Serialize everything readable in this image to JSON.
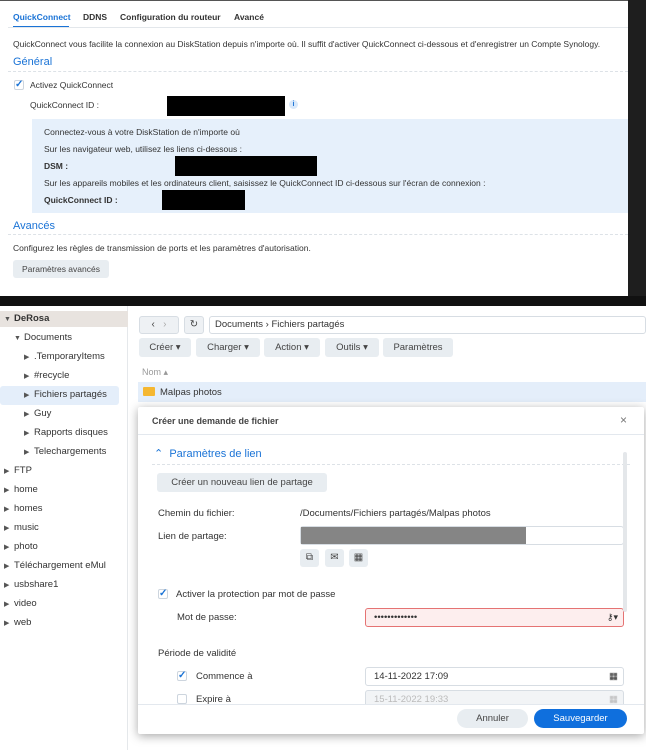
{
  "quickconnect": {
    "tabs": [
      "QuickConnect",
      "DDNS",
      "Configuration du routeur",
      "Avancé"
    ],
    "intro": "QuickConnect vous facilite la connexion au DiskStation depuis n'importe où. Il suffit d'activer QuickConnect ci-dessous et d'enregistrer un Compte Synology.",
    "general_title": "Général",
    "enable_label": "Activez QuickConnect",
    "id_label": "QuickConnect ID :",
    "info_icon": "i",
    "box_line1": "Connectez-vous à votre DiskStation de n'importe où",
    "box_line2": "Sur les navigateur web, utilisez les liens ci-dessous :",
    "dsm_label": "DSM :",
    "box_line3": "Sur les appareils mobiles et les ordinateurs client, saisissez le QuickConnect ID ci-dessous sur l'écran de connexion :",
    "box_id_label": "QuickConnect ID :",
    "advanced_title": "Avancés",
    "advanced_desc": "Configurez les règles de transmission de ports et les paramètres d'autorisation.",
    "advanced_button": "Paramètres avancés"
  },
  "sidebar": {
    "root": "DeRosa",
    "items": [
      {
        "label": "Documents",
        "level": 1,
        "open": true
      },
      {
        "label": ".TemporaryItems",
        "level": 2
      },
      {
        "label": "#recycle",
        "level": 2
      },
      {
        "label": "Fichiers partagés",
        "level": 2,
        "selected": true
      },
      {
        "label": "Guy",
        "level": 2
      },
      {
        "label": "Rapports disques",
        "level": 2
      },
      {
        "label": "Telechargements",
        "level": 2
      },
      {
        "label": "FTP",
        "level": 0
      },
      {
        "label": "home",
        "level": 0
      },
      {
        "label": "homes",
        "level": 0
      },
      {
        "label": "music",
        "level": 0
      },
      {
        "label": "photo",
        "level": 0
      },
      {
        "label": "Téléchargement eMul",
        "level": 0
      },
      {
        "label": "usbshare1",
        "level": 0
      },
      {
        "label": "video",
        "level": 0
      },
      {
        "label": "web",
        "level": 0
      }
    ]
  },
  "filestation": {
    "breadcrumb": "Documents › Fichiers partagés",
    "toolbar": [
      "Créer",
      "Charger",
      "Action",
      "Outils",
      "Paramètres"
    ],
    "column_name": "Nom",
    "rows": [
      "Malpas photos"
    ]
  },
  "dialog": {
    "title": "Créer une demande de fichier",
    "section": "Paramètres de lien",
    "new_link_button": "Créer un nouveau lien de partage",
    "path_label": "Chemin du fichier:",
    "path_value": "/Documents/Fichiers partagés/Malpas photos",
    "link_label": "Lien de partage:",
    "password_protect_label": "Activer la protection par mot de passe",
    "password_label": "Mot de passe:",
    "password_value": "•••••••••••••",
    "validity_title": "Période de validité",
    "start_label": "Commence à",
    "start_value": "14-11-2022 17:09",
    "expire_label": "Expire à",
    "expire_value": "15-11-2022 19:33",
    "cancel": "Annuler",
    "save": "Sauvegarder"
  }
}
